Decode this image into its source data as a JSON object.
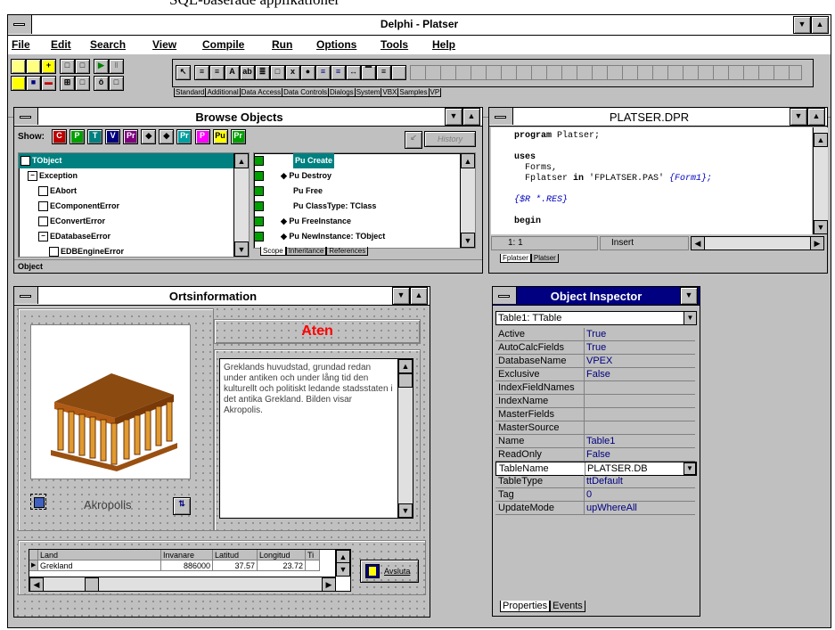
{
  "caption": "SQL-baserade applikationer",
  "ide": {
    "title": "Delphi - Platser",
    "menu": [
      "File",
      "Edit",
      "Search",
      "View",
      "Compile",
      "Run",
      "Options",
      "Tools",
      "Help"
    ],
    "palette_tabs": [
      "Standard",
      "Additional",
      "Data Access",
      "Data Controls",
      "Dialogs",
      "System",
      "VBX",
      "Samples",
      "VP"
    ]
  },
  "browse": {
    "title": "Browse Objects",
    "show_label": "Show:",
    "history": "History",
    "tree": [
      "TObject",
      "Exception",
      "EAbort",
      "EComponentError",
      "EConvertError",
      "EDatabaseError",
      "EDBEngineError"
    ],
    "members": [
      "Create",
      "Destroy",
      "Free",
      "ClassType: TClass",
      "FreeInstance",
      "NewInstance: TObject"
    ],
    "tabs": [
      "Scope",
      "Inheritance",
      "References"
    ],
    "status": "Object"
  },
  "editor": {
    "title": "PLATSER.DPR",
    "lines": {
      "l1a": "program",
      "l1b": " Platser;",
      "l2": "uses",
      "l3": "  Forms,",
      "l4a": "  Fplatser ",
      "l4b": "in",
      "l4c": " 'FPLATSER.PAS' ",
      "l4d": "{Form1};",
      "l5": "{$R *.RES}",
      "l6": "begin"
    },
    "pos": "1: 1",
    "mode": "Insert",
    "tabs": [
      "Fplatser",
      "Platser"
    ]
  },
  "form": {
    "title": "Ortsinformation",
    "city": "Aten",
    "description": "Greklands huvudstad, grundad redan under antiken och under lång tid den kulturellt och politiskt ledande stadsstaten i det antika Grekland. Bilden visar Akropolis.",
    "image_caption": "Akropolis",
    "grid_headers": [
      "Land",
      "Invanare",
      "Latitud",
      "Longitud",
      "Ti"
    ],
    "grid_row": [
      "Grekland",
      "886000",
      "37.57",
      "23.72",
      ""
    ],
    "close_button": "Avsluta"
  },
  "inspector": {
    "title": "Object Inspector",
    "object": "Table1: TTable",
    "rows": [
      {
        "p": "Active",
        "v": "True"
      },
      {
        "p": "AutoCalcFields",
        "v": "True"
      },
      {
        "p": "DatabaseName",
        "v": "VPEX"
      },
      {
        "p": "Exclusive",
        "v": "False"
      },
      {
        "p": "IndexFieldNames",
        "v": ""
      },
      {
        "p": "IndexName",
        "v": ""
      },
      {
        "p": "MasterFields",
        "v": ""
      },
      {
        "p": "MasterSource",
        "v": ""
      },
      {
        "p": "Name",
        "v": "Table1"
      },
      {
        "p": "ReadOnly",
        "v": "False"
      },
      {
        "p": "TableName",
        "v": "PLATSER.DB"
      },
      {
        "p": "TableType",
        "v": "ttDefault"
      },
      {
        "p": "Tag",
        "v": "0"
      },
      {
        "p": "UpdateMode",
        "v": "upWhereAll"
      }
    ],
    "tabs": [
      "Properties",
      "Events"
    ]
  },
  "colors": {
    "accent": "#000080",
    "red": "#ff0000",
    "face": "#c0c0c0"
  }
}
